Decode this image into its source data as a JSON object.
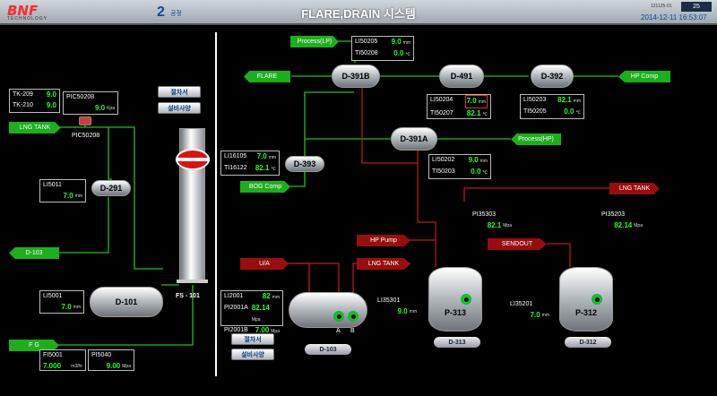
{
  "header": {
    "logo": "BNF",
    "logo_sub": "TECHNOLOGY",
    "plant_num": "2",
    "plant_label": "공정",
    "title": "FLARE,DRAIN 시스템",
    "small_id": "121125-01",
    "badge": "25",
    "datetime": "2014-12-11 16:53:07"
  },
  "arrows": {
    "process_lp": "Process(LP)",
    "flare": "FLARE",
    "hp_comp": "HP Comp",
    "lng_tank_left": "LNG TANK",
    "process_hp": "Process(HP)",
    "bog_comp": "BOG Comp",
    "d103_left": "D-103",
    "fg": "F G",
    "lng_tank_right": "LNG TANK",
    "hp_pump": "HP Pump",
    "sendout": "SENDOUT",
    "ua": "U/A",
    "lng_tank_mid": "LNG TANK"
  },
  "vessels": {
    "d391b": "D-391B",
    "d491": "D-491",
    "d392": "D-392",
    "d391a": "D-391A",
    "d393": "D-393",
    "d291": "D-291",
    "d101": "D-101",
    "p313": "P-313",
    "p312": "P-312",
    "fs101": "FS - 101"
  },
  "boxes": {
    "tk209": {
      "label": "TK-209",
      "value": "9.0"
    },
    "tk210": {
      "label": "TK-210",
      "value": "9.0"
    },
    "pic50208": {
      "label": "PIC50208",
      "value": "9.0",
      "unit": "Kpa"
    },
    "pic_tag": "PIC50208",
    "li5011": {
      "label": "LI5011",
      "value": "7.0",
      "unit": "mm"
    },
    "li5001": {
      "label": "LI5001",
      "value": "7.0",
      "unit": "mm"
    },
    "fi5001": {
      "label": "FI5001",
      "value": "7.000",
      "unit": "m3/hr"
    },
    "pi5040": {
      "label": "PI5040",
      "value": "9.00",
      "unit": "Mpa"
    },
    "li50205": {
      "label": "LI50205",
      "value": "9.0",
      "unit": "mm"
    },
    "ti50208": {
      "label": "TI50208",
      "value": "0.0",
      "unit": "℃"
    },
    "li50204": {
      "label": "LI50204",
      "value": "7.0",
      "unit": "mm"
    },
    "ti50207": {
      "label": "TI50207",
      "value": "82.1",
      "unit": "℃"
    },
    "li50203": {
      "label": "LI50203",
      "value": "82.1",
      "unit": "mm"
    },
    "ti50205": {
      "label": "TI50205",
      "value": "0.0",
      "unit": "℃"
    },
    "li16105": {
      "label": "LI16105",
      "value": "7.0",
      "unit": "mm"
    },
    "ti16122": {
      "label": "TI16122",
      "value": "82.1",
      "unit": "℃"
    },
    "li50202": {
      "label": "LI50202",
      "value": "9.0",
      "unit": "mm"
    },
    "ti50203": {
      "label": "TI50203",
      "value": "0.0",
      "unit": "℃"
    },
    "pi35303": {
      "label": "PI35303",
      "value": "82.1",
      "unit": "Mpa"
    },
    "pi35203": {
      "label": "PI35203",
      "value": "82.14",
      "unit": "Mpa"
    },
    "li2001": {
      "label": "LI2001",
      "value": "82",
      "unit": "mm"
    },
    "pi2001a": {
      "label": "PI2001A",
      "value": "82.14",
      "unit": "Mpa"
    },
    "pi2001b": {
      "label": "PI2001B",
      "value": "7.00",
      "unit": "Mpa"
    },
    "li35301": {
      "label": "LI35301",
      "value": "9.0",
      "unit": "mm"
    },
    "li35201": {
      "label": "LI35201",
      "value": "7.0",
      "unit": "mm"
    }
  },
  "buttons": {
    "jeoljaseo1": "절차서",
    "seolbi1": "설비사양",
    "jeoljaseo2": "절차서",
    "seolbi2": "설비사양",
    "d103": "D-103",
    "d313": "D-313",
    "d312": "D-312"
  },
  "pump_labels": {
    "a": "A",
    "b": "B"
  }
}
